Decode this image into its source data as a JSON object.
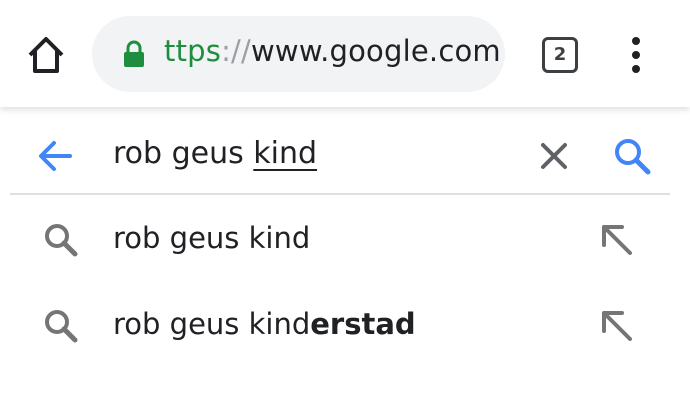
{
  "toolbar": {
    "url_scheme": "ttps",
    "url_separator": "://",
    "url_host": "www.google.com",
    "tab_count": "2",
    "icons": {
      "home": "home-icon",
      "lock": "lock-icon",
      "tabs": "tab-switcher-icon",
      "menu": "more-vert-icon"
    },
    "colors": {
      "secure_green": "#1e8e3e",
      "omnibox_bg": "#f1f3f4"
    }
  },
  "search": {
    "query_prefix": "rob geus ",
    "query_composing": "kind",
    "icons": {
      "back": "back-arrow-icon",
      "clear": "close-icon",
      "submit": "search-icon"
    },
    "accent_color": "#4285f4"
  },
  "suggestions": [
    {
      "plain": "rob geus kind",
      "bold": "",
      "icon": "search-icon",
      "action_icon": "arrow-up-left-icon"
    },
    {
      "plain": "rob geus kind",
      "bold": "erstad",
      "icon": "search-icon",
      "action_icon": "arrow-up-left-icon"
    }
  ]
}
